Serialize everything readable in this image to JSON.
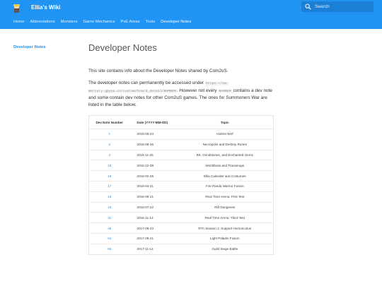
{
  "header": {
    "site_title": "Ellia's Wiki",
    "search_placeholder": "Search",
    "tabs": [
      {
        "label": "Home",
        "active": false
      },
      {
        "label": "Abbreviations",
        "active": false
      },
      {
        "label": "Monsters",
        "active": false
      },
      {
        "label": "Game Mechanics",
        "active": false
      },
      {
        "label": "PvE Areas",
        "active": false
      },
      {
        "label": "Tools",
        "active": false
      },
      {
        "label": "Developer Notes",
        "active": true
      }
    ]
  },
  "sidebar": {
    "items": [
      {
        "label": "Developer Notes"
      }
    ]
  },
  "main": {
    "title": "Developer Notes",
    "intro": "This site contains info about the Developer Notes shared by Com2uS.",
    "access_prefix": "The developer notes can permanently be accessed under",
    "access_url": "https://sw-mercury.qpyou.cn/custom/board_detail/NUMBER",
    "access_middle": ". However not every",
    "access_code": "NUMBER",
    "access_suffix": "contains a dev note and some contain dev notes for other Com2uS games. The ones for Summoners War are listed in the table below."
  },
  "table": {
    "headers": [
      "Dev Note Number",
      "Date (YYYY-MM-DD)",
      "Topic"
    ],
    "rows": [
      {
        "number": "1",
        "date": "2015-06-24",
        "topic": "Violent Nerf"
      },
      {
        "number": "2",
        "date": "2015-08-26",
        "topic": "Necropolis and Destroy Runes"
      },
      {
        "number": "4",
        "date": "2015-11-25",
        "topic": "R5, Grindstones, and Enchanted Gems"
      },
      {
        "number": "15",
        "date": "2015-12-09",
        "topic": "Worldboss and Transmogs"
      },
      {
        "number": "16",
        "date": "2016-02-05",
        "topic": "Ellia Calender and Costumes"
      },
      {
        "number": "17",
        "date": "2016-04-21",
        "topic": "Fire Panda Warrior Fusion"
      },
      {
        "number": "18",
        "date": "2016-06-21",
        "topic": "Real Time Arena: First Test"
      },
      {
        "number": "19",
        "date": "2016-07-22",
        "topic": "Rift Dungeons"
      },
      {
        "number": "31",
        "date": "2016-11-14",
        "topic": "Real Time Arena: Third Test"
      },
      {
        "number": "48",
        "date": "2017-06-23",
        "topic": "RTA Season 2, Support Homunculus"
      },
      {
        "number": "54",
        "date": "2017-09-21",
        "topic": "Light Paladin Fusion"
      },
      {
        "number": "55",
        "date": "2017-11-14",
        "topic": "Guild Siege Battle"
      }
    ]
  }
}
